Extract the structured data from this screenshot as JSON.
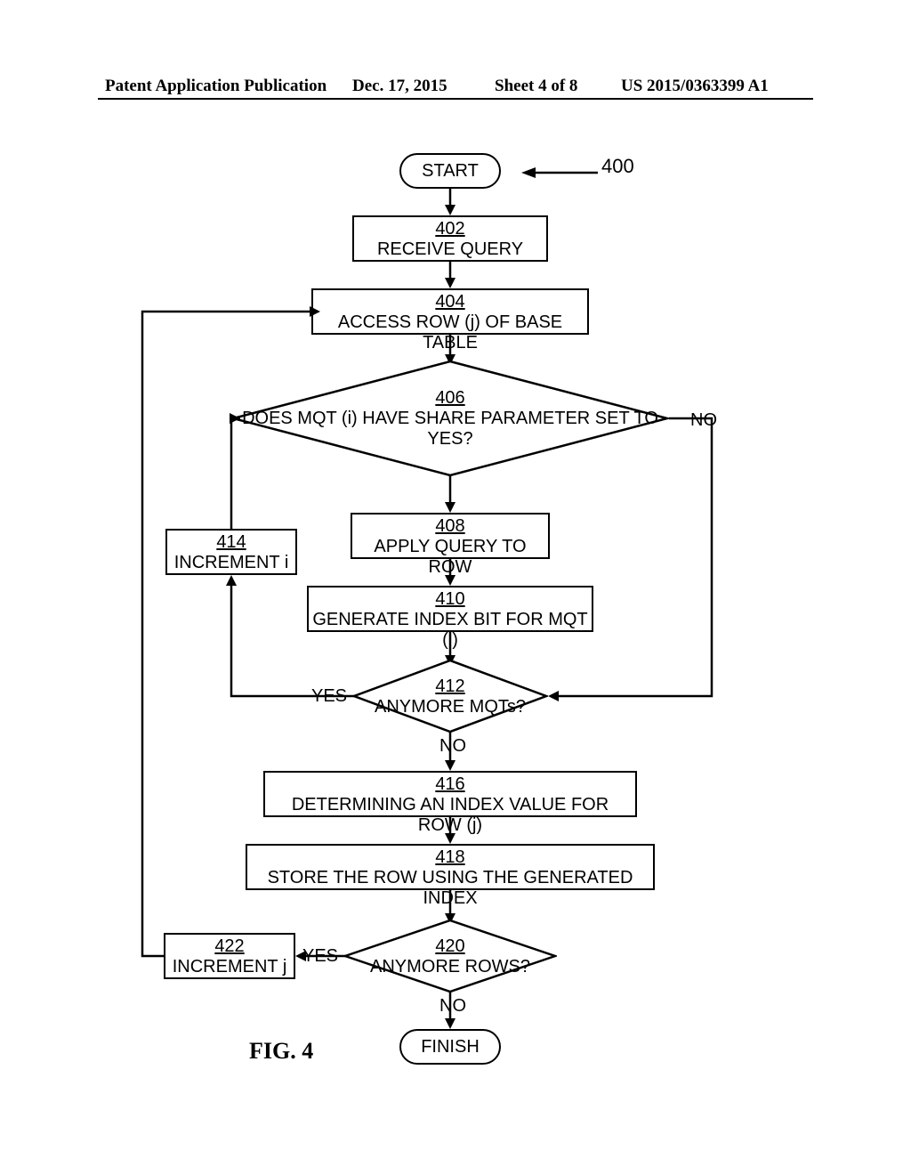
{
  "header": {
    "left": "Patent Application Publication",
    "date": "Dec. 17, 2015",
    "sheet": "Sheet 4 of 8",
    "pubno": "US 2015/0363399 A1"
  },
  "refnum": "400",
  "figcaption": "FIG. 4",
  "terminals": {
    "start": "START",
    "finish": "FINISH"
  },
  "steps": {
    "s402": {
      "no": "402",
      "text": "RECEIVE QUERY"
    },
    "s404": {
      "no": "404",
      "text": "ACCESS ROW (j) OF BASE TABLE"
    },
    "s406": {
      "no": "406",
      "text": "DOES MQT (i) HAVE SHARE PARAMETER SET TO YES?"
    },
    "s408": {
      "no": "408",
      "text": "APPLY QUERY TO ROW"
    },
    "s410": {
      "no": "410",
      "text": "GENERATE INDEX BIT FOR MQT (i)"
    },
    "s412": {
      "no": "412",
      "text": "ANYMORE MQTs?"
    },
    "s414": {
      "no": "414",
      "text": "INCREMENT i"
    },
    "s416": {
      "no": "416",
      "text": "DETERMINING AN INDEX VALUE FOR ROW (j)"
    },
    "s418": {
      "no": "418",
      "text": "STORE THE ROW USING THE GENERATED INDEX"
    },
    "s420": {
      "no": "420",
      "text": "ANYMORE ROWS?"
    },
    "s422": {
      "no": "422",
      "text": "INCREMENT j"
    }
  },
  "labels": {
    "yes": "YES",
    "no": "NO"
  }
}
